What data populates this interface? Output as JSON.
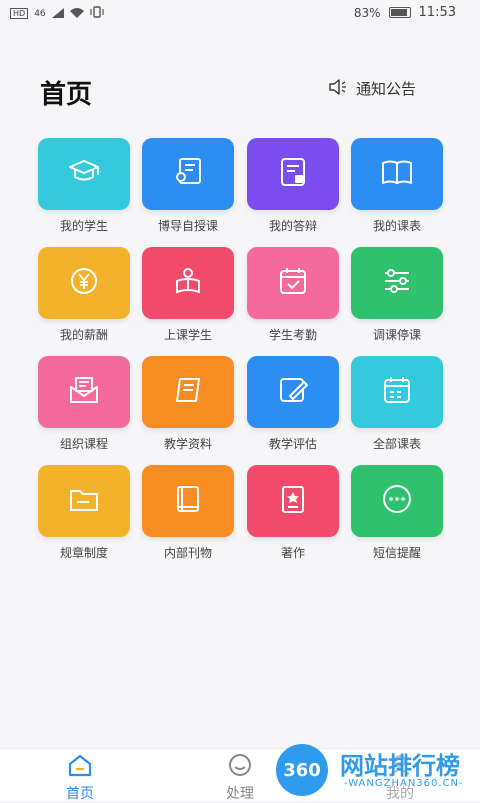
{
  "status_bar": {
    "signal": "46",
    "battery": "83%",
    "time": "11:53"
  },
  "header": {
    "title": "首页",
    "notice_label": "通知公告",
    "notice_icon": "speaker-icon"
  },
  "tiles": [
    {
      "label": "我的学生",
      "icon": "graduation-cap-icon",
      "color": "#35c9de"
    },
    {
      "label": "博导自授课",
      "icon": "teacher-board-icon",
      "color": "#2c8df2"
    },
    {
      "label": "我的答辩",
      "icon": "defense-doc-icon",
      "color": "#7b4df0"
    },
    {
      "label": "我的课表",
      "icon": "open-book-icon",
      "color": "#2c8df2"
    },
    {
      "label": "我的薪酬",
      "icon": "yen-coin-icon",
      "color": "#f2b22c"
    },
    {
      "label": "上课学生",
      "icon": "student-reading-icon",
      "color": "#f24a6b"
    },
    {
      "label": "学生考勤",
      "icon": "calendar-check-icon",
      "color": "#f46a9a"
    },
    {
      "label": "调课停课",
      "icon": "sliders-icon",
      "color": "#2fc16e"
    },
    {
      "label": "组织课程",
      "icon": "envelope-doc-icon",
      "color": "#f46a9a"
    },
    {
      "label": "教学资料",
      "icon": "book-stack-icon",
      "color": "#f78d22"
    },
    {
      "label": "教学评估",
      "icon": "edit-pen-icon",
      "color": "#2c8df2"
    },
    {
      "label": "全部课表",
      "icon": "calendar-grid-icon",
      "color": "#35c9de"
    },
    {
      "label": "规章制度",
      "icon": "folder-icon",
      "color": "#f2b22c"
    },
    {
      "label": "内部刊物",
      "icon": "magazine-icon",
      "color": "#f78d22"
    },
    {
      "label": "著作",
      "icon": "award-book-icon",
      "color": "#f24a6b"
    },
    {
      "label": "短信提醒",
      "icon": "message-dots-icon",
      "color": "#2fc16e"
    }
  ],
  "tabs": [
    {
      "label": "首页",
      "icon": "home-icon",
      "active": true,
      "color": "#2c8df2"
    },
    {
      "label": "处理",
      "icon": "smile-icon",
      "active": false,
      "color": "#888888"
    },
    {
      "label": "我的",
      "icon": "user-icon",
      "active": false,
      "color": "#888888"
    }
  ],
  "watermark": {
    "logo_text": "360",
    "title": "网站排行榜",
    "subtitle": "-WANGZHAN360.CN-"
  }
}
